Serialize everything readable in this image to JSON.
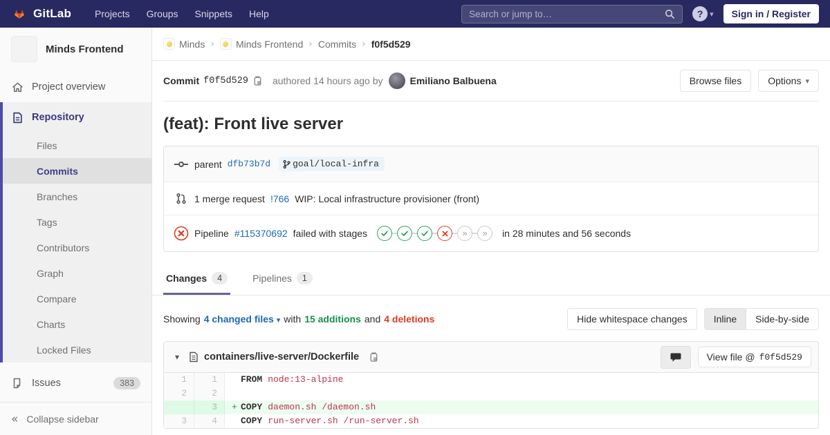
{
  "navbar": {
    "logo": "GitLab",
    "menu": [
      "Projects",
      "Groups",
      "Snippets",
      "Help"
    ],
    "search_placeholder": "Search or jump to…",
    "sign_in": "Sign in / Register"
  },
  "sidebar": {
    "project_name": "Minds Frontend",
    "project_overview": "Project overview",
    "repository": "Repository",
    "repo_items": [
      "Files",
      "Commits",
      "Branches",
      "Tags",
      "Contributors",
      "Graph",
      "Compare",
      "Charts",
      "Locked Files"
    ],
    "repo_active_item": "Commits",
    "issues": "Issues",
    "issues_count": "383",
    "collapse": "Collapse sidebar"
  },
  "breadcrumb": {
    "group": "Minds",
    "project": "Minds Frontend",
    "section": "Commits",
    "sha": "f0f5d529"
  },
  "commit_header": {
    "label": "Commit",
    "sha": "f0f5d529",
    "authored": "authored 14 hours ago by",
    "author": "Emiliano Balbuena",
    "browse_files": "Browse files",
    "options": "Options"
  },
  "commit": {
    "title": "(feat): Front live server",
    "parent_label": "parent",
    "parent_sha": "dfb73b7d",
    "branch": "goal/local-infra",
    "mr_count_text": "1 merge request",
    "mr_id": "!766",
    "mr_title": "WIP: Local infrastructure provisioner (front)",
    "pipeline_label": "Pipeline",
    "pipeline_id": "#115370692",
    "pipeline_status_text": "failed with stages",
    "pipeline_duration": "in 28 minutes and 56 seconds",
    "stages": [
      "success",
      "success",
      "success",
      "failed",
      "skipped",
      "skipped"
    ]
  },
  "tabs": {
    "changes": "Changes",
    "changes_count": "4",
    "pipelines": "Pipelines",
    "pipelines_count": "1"
  },
  "diff_summary": {
    "showing": "Showing",
    "files_link": "4 changed files",
    "with_word": "with",
    "additions": "15 additions",
    "and_word": "and",
    "deletions": "4 deletions",
    "hide_whitespace": "Hide whitespace changes",
    "inline": "Inline",
    "side_by_side": "Side-by-side"
  },
  "diff_file": {
    "path": "containers/live-server/Dockerfile",
    "view_file_prefix": "View file @",
    "view_file_sha": "f0f5d529",
    "lines": [
      {
        "old": "1",
        "new": "1",
        "sign": "",
        "keyword": "FROM",
        "code": "node:13-alpine",
        "type": "context"
      },
      {
        "old": "2",
        "new": "2",
        "sign": "",
        "keyword": "",
        "code": "",
        "type": "context"
      },
      {
        "old": "",
        "new": "3",
        "sign": "+",
        "keyword": "COPY",
        "code": "daemon.sh /daemon.sh",
        "type": "added"
      },
      {
        "old": "3",
        "new": "4",
        "sign": "",
        "keyword": "COPY",
        "code": "run-server.sh /run-server.sh",
        "type": "context"
      }
    ]
  },
  "icons": {
    "help-icon": "?",
    "chevron-down-icon": "▾",
    "collapse-sidebar-icon": "«",
    "breadcrumb-separator": "›",
    "skipped-stage-icon": "»"
  },
  "colors": {
    "navbar_bg": "#292961",
    "sidebar_accent": "#4b4ba8",
    "link_blue": "#1b69b6",
    "success_green": "#2da160",
    "failed_red": "#db3b21",
    "addition_green": "#168f48",
    "deletion_red": "#db3b21",
    "branch_badge_bg": "#ecf4fb",
    "added_line_bg": "#ecfdf0"
  }
}
